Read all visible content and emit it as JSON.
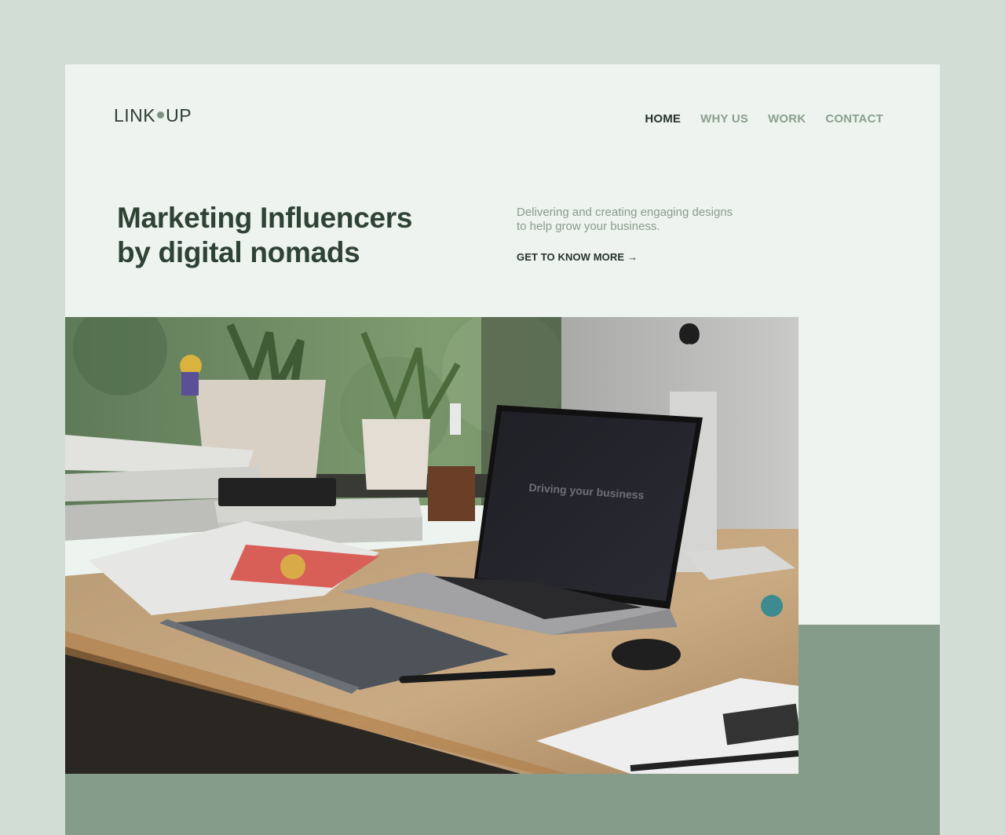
{
  "brand": {
    "logo_left": "LINK",
    "logo_right": "UP"
  },
  "nav": {
    "items": [
      {
        "label": "HOME",
        "active": true
      },
      {
        "label": "WHY US",
        "active": false
      },
      {
        "label": "WORK",
        "active": false
      },
      {
        "label": "CONTACT",
        "active": false
      }
    ]
  },
  "hero": {
    "headline_line1": "Marketing Influencers",
    "headline_line2": "by digital nomads",
    "tagline_line1": "Delivering and creating engaging designs",
    "tagline_line2": "to help grow your business.",
    "cta_label": "GET TO KNOW MORE",
    "cta_icon": "arrow-right-icon",
    "cta_arrow": "→",
    "photo_screen_text": "Driving your business"
  },
  "colors": {
    "page_bg": "#d2ded5",
    "card_bg": "#edf3ee",
    "accent_green": "#869c8a",
    "text_dark": "#2f4236",
    "nav_inactive": "#8aa08f"
  }
}
